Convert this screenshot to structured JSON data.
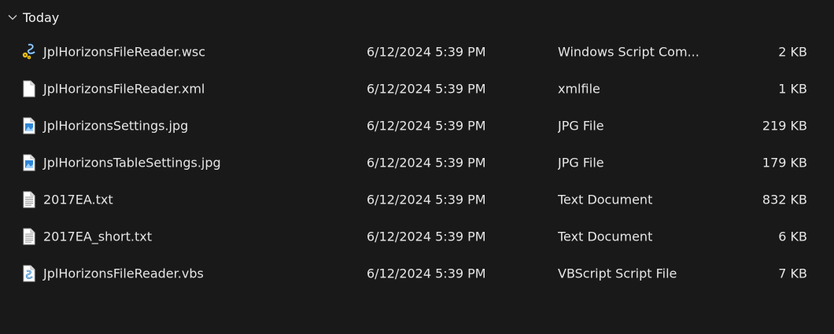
{
  "group": {
    "label": "Today",
    "expanded": true,
    "icon": "chevron-down-icon"
  },
  "files": [
    {
      "name": "JplHorizonsFileReader.wsc",
      "date": "6/12/2024 5:39 PM",
      "type": "Windows Script Com...",
      "size": "2 KB",
      "icon": "wsc-file-icon"
    },
    {
      "name": "JplHorizonsFileReader.xml",
      "date": "6/12/2024 5:39 PM",
      "type": "xmlfile",
      "size": "1 KB",
      "icon": "blank-file-icon"
    },
    {
      "name": "JplHorizonsSettings.jpg",
      "date": "6/12/2024 5:39 PM",
      "type": "JPG File",
      "size": "219 KB",
      "icon": "image-file-icon"
    },
    {
      "name": "JplHorizonsTableSettings.jpg",
      "date": "6/12/2024 5:39 PM",
      "type": "JPG File",
      "size": "179 KB",
      "icon": "image-file-icon"
    },
    {
      "name": "2017EA.txt",
      "date": "6/12/2024 5:39 PM",
      "type": "Text Document",
      "size": "832 KB",
      "icon": "text-file-icon"
    },
    {
      "name": "2017EA_short.txt",
      "date": "6/12/2024 5:39 PM",
      "type": "Text Document",
      "size": "6 KB",
      "icon": "text-file-icon"
    },
    {
      "name": "JplHorizonsFileReader.vbs",
      "date": "6/12/2024 5:39 PM",
      "type": "VBScript Script File",
      "size": "7 KB",
      "icon": "vbs-file-icon"
    }
  ],
  "colors": {
    "background": "#191919",
    "text": "#e6e6e6"
  }
}
